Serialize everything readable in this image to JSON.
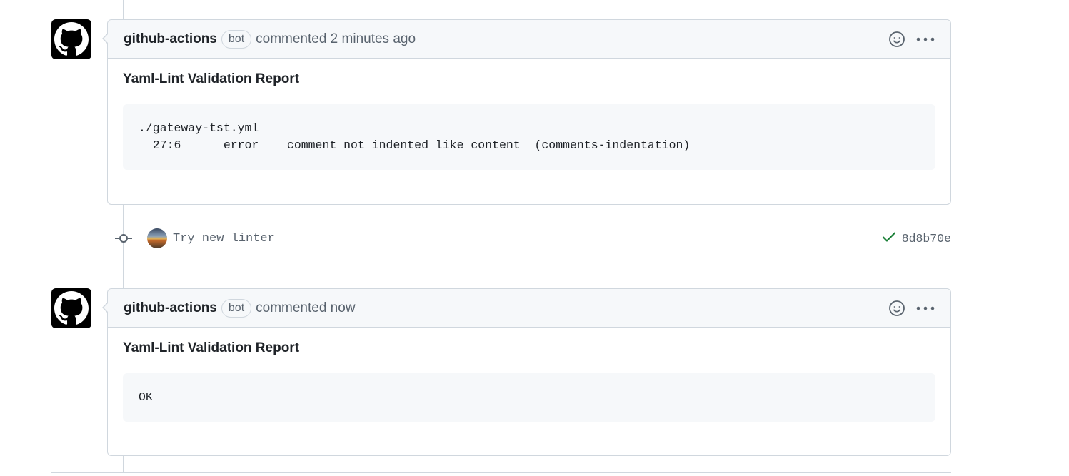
{
  "comments": [
    {
      "author": "github-actions",
      "badge": "bot",
      "meta": "commented 2 minutes ago",
      "title": "Yaml-Lint Validation Report",
      "code": "./gateway-tst.yml\n  27:6      error    comment not indented like content  (comments-indentation)"
    },
    {
      "author": "github-actions",
      "badge": "bot",
      "meta": "commented now",
      "title": "Yaml-Lint Validation Report",
      "code": "OK"
    }
  ],
  "commit": {
    "message": "Try new linter",
    "sha": "8d8b70e",
    "status_color": "#1a7f37"
  },
  "icons": {
    "avatar": "github-mark-icon",
    "reaction": "smiley-icon",
    "more": "kebab-horizontal-icon",
    "commit": "git-commit-icon",
    "status": "check-icon"
  }
}
